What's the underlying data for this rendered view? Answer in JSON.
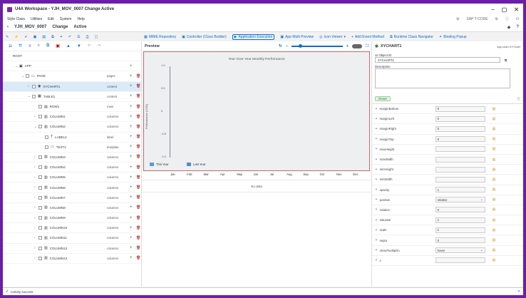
{
  "window": {
    "title": "U4A Workspace - YJH_MOV_0007 Change Active"
  },
  "menu": {
    "items": [
      "Style Class",
      "Utilities",
      "Edit",
      "System",
      "Help"
    ],
    "sap_t_code": "SAP T-CODE"
  },
  "shell": {
    "app": "YJH_MOV_0007",
    "mode": "Change",
    "status": "Active"
  },
  "toolbar": {
    "buttons": [
      "MIME Repository",
      "Controller (Class Builder)",
      "Application Execution",
      "App Multi Preview",
      "Icon Viewer",
      "Add Event Method",
      "Runtime Class Navigator",
      "Binding Popup"
    ]
  },
  "tree": {
    "rows": [
      {
        "name": "ROOT",
        "type": "",
        "level": 0,
        "chev": "",
        "icon": ""
      },
      {
        "name": "APP",
        "type": "",
        "level": 1,
        "chev": "v",
        "icon": "▣"
      },
      {
        "name": "PAGE",
        "type": "pages",
        "level": 2,
        "chev": "v",
        "icon": "▭"
      },
      {
        "name": "XYCHART1",
        "type": "content",
        "level": 3,
        "chev": ">",
        "icon": "◉",
        "sel": true
      },
      {
        "name": "TABLE1",
        "type": "content",
        "level": 3,
        "chev": "v",
        "icon": "▦"
      },
      {
        "name": "ROW1",
        "type": "rows",
        "level": 4,
        "chev": "",
        "icon": "▤"
      },
      {
        "name": "COLUMN1",
        "type": "columns",
        "level": 4,
        "chev": ">",
        "icon": "▥"
      },
      {
        "name": "COLUMN2",
        "type": "columns",
        "level": 4,
        "chev": "v",
        "icon": "▥"
      },
      {
        "name": "LABEL2",
        "type": "label",
        "level": 5,
        "chev": "",
        "icon": "T"
      },
      {
        "name": "TEXT2",
        "type": "template",
        "level": 5,
        "chev": "",
        "icon": "▭"
      },
      {
        "name": "COLUMN3",
        "type": "columns",
        "level": 4,
        "chev": ">",
        "icon": "▥"
      },
      {
        "name": "COLUMN4",
        "type": "columns",
        "level": 4,
        "chev": ">",
        "icon": "▥"
      },
      {
        "name": "COLUMN5",
        "type": "columns",
        "level": 4,
        "chev": ">",
        "icon": "▥"
      },
      {
        "name": "COLUMN6",
        "type": "columns",
        "level": 4,
        "chev": ">",
        "icon": "▥"
      },
      {
        "name": "COLUMN7",
        "type": "columns",
        "level": 4,
        "chev": ">",
        "icon": "▥"
      },
      {
        "name": "COLUMN8",
        "type": "columns",
        "level": 4,
        "chev": ">",
        "icon": "▥"
      },
      {
        "name": "COLUMN9",
        "type": "columns",
        "level": 4,
        "chev": ">",
        "icon": "▥"
      },
      {
        "name": "COLUMN10",
        "type": "columns",
        "level": 4,
        "chev": ">",
        "icon": "▥"
      },
      {
        "name": "COLUMN11",
        "type": "columns",
        "level": 4,
        "chev": ">",
        "icon": "▥"
      },
      {
        "name": "COLUMN12",
        "type": "columns",
        "level": 4,
        "chev": ">",
        "icon": "▥"
      },
      {
        "name": "COLUMN13",
        "type": "columns",
        "level": 4,
        "chev": ">",
        "icon": "▥"
      }
    ]
  },
  "preview": {
    "label": "Preview",
    "no_data": "No data",
    "months": [
      "Jan",
      "Feb",
      "Mar",
      "Apr",
      "May",
      "Jun",
      "Jul",
      "Aug",
      "Sep",
      "Oct",
      "Nov",
      "Dec"
    ]
  },
  "chart_data": {
    "type": "line",
    "title": "Year Over Year Monthly Performance",
    "ylabel": "Performance (USD)",
    "ylim": [
      -1,
      1
    ],
    "yticks": [
      "1.0",
      "0.5",
      "0",
      "-0.5",
      "-1.0"
    ],
    "series": [
      {
        "name": "This Year",
        "color": "#5b9bd5",
        "values": []
      },
      {
        "name": "Last Year",
        "color": "#5b8bc4",
        "values": []
      }
    ]
  },
  "props": {
    "title": "XYCHART1",
    "path": "sap.chart.XYChart",
    "ui_object_id_label": "UI Object ID",
    "ui_object_id": "XYCHART1",
    "description_label": "Description",
    "reset": "Reset",
    "rows": [
      {
        "name": "marginBottom",
        "value": "0"
      },
      {
        "name": "marginLeft",
        "value": "0"
      },
      {
        "name": "marginRight",
        "value": "0"
      },
      {
        "name": "marginTop",
        "value": "0"
      },
      {
        "name": "maxHeight",
        "value": ""
      },
      {
        "name": "maxWidth",
        "value": ""
      },
      {
        "name": "minHeight",
        "value": ""
      },
      {
        "name": "minWidth",
        "value": ""
      },
      {
        "name": "opacity",
        "value": "1"
      },
      {
        "name": "position",
        "value": "relative",
        "dd": true
      },
      {
        "name": "rotation",
        "value": "0"
      },
      {
        "name": "saturate",
        "value": "1"
      },
      {
        "name": "scale",
        "value": "1"
      },
      {
        "name": "sepia",
        "value": "0"
      },
      {
        "name": "showTooltipOn",
        "value": "hover",
        "dd": true
      },
      {
        "name": "x",
        "value": ""
      }
    ]
  },
  "status": {
    "text": "Activity success"
  }
}
